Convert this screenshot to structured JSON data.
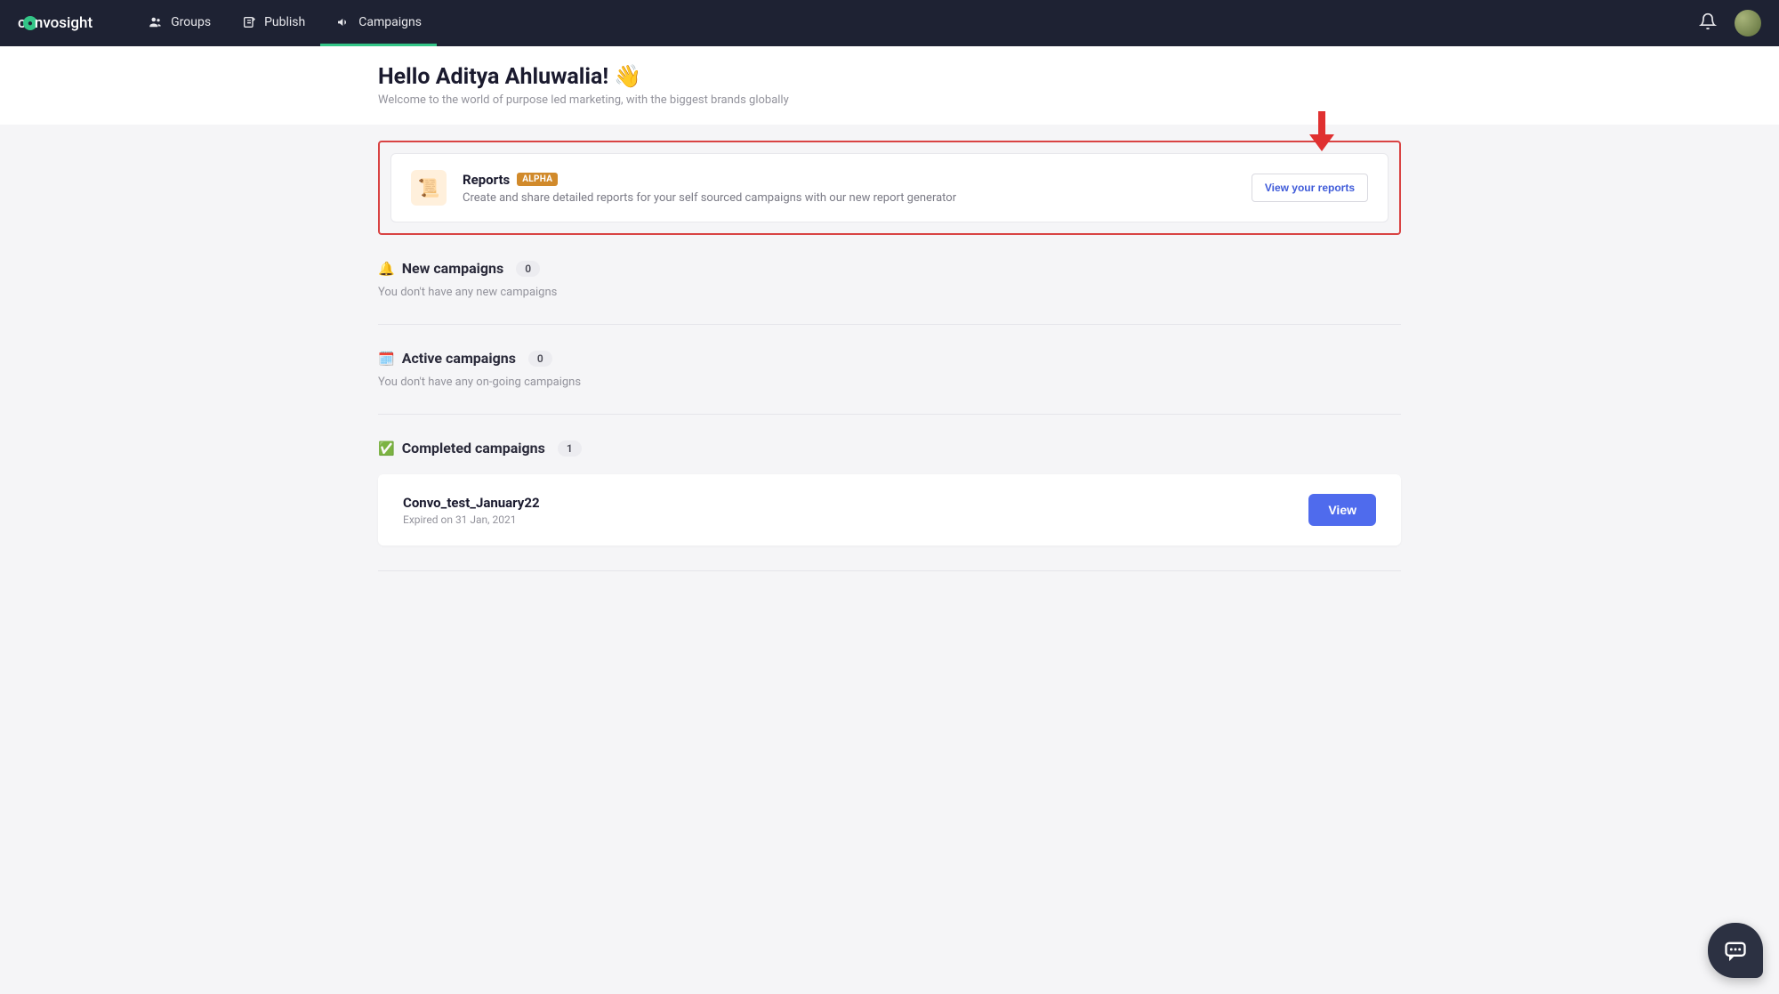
{
  "brand": {
    "prefix": "c",
    "suffix": "nvosight"
  },
  "nav": {
    "groups": "Groups",
    "publish": "Publish",
    "campaigns": "Campaigns"
  },
  "header": {
    "greeting": "Hello Aditya Ahluwalia!",
    "wave": "👋",
    "subtitle": "Welcome to the world of purpose led marketing, with the biggest brands globally"
  },
  "reports": {
    "title": "Reports",
    "badge": "ALPHA",
    "desc": "Create and share detailed reports for your self sourced campaigns with our new report generator",
    "button": "View your reports",
    "icon": "📜"
  },
  "sections": {
    "new": {
      "emoji": "🔔",
      "title": "New campaigns",
      "count": "0",
      "empty": "You don't have any new campaigns"
    },
    "active": {
      "emoji": "🗓️",
      "title": "Active campaigns",
      "count": "0",
      "empty": "You don't have any on-going campaigns"
    },
    "completed": {
      "emoji": "✅",
      "title": "Completed campaigns",
      "count": "1"
    }
  },
  "campaign": {
    "name": "Convo_test_January22",
    "expiry": "Expired on 31 Jan, 2021",
    "viewButton": "View"
  }
}
